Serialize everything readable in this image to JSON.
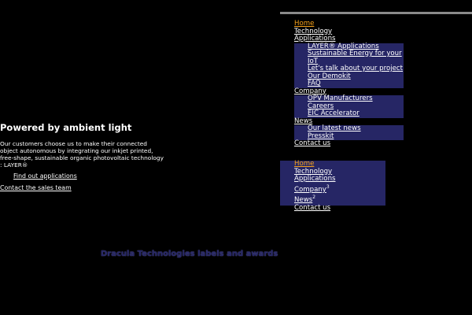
{
  "menu_primary": {
    "items": [
      {
        "label": "Home"
      },
      {
        "label": "Technology"
      },
      {
        "label": "Applications",
        "children": [
          {
            "label": "LAYER® Applications"
          },
          {
            "label": "Sustainable Energy for your IoT"
          },
          {
            "label": "Let's talk about your project"
          },
          {
            "label": "Our Demokit"
          },
          {
            "label": "FAQ"
          }
        ]
      },
      {
        "label": "Company",
        "children": [
          {
            "label": "OPV Manufacturers"
          },
          {
            "label": "Careers"
          },
          {
            "label": "EIC Accelerator"
          }
        ]
      },
      {
        "label": "News",
        "children": [
          {
            "label": "Our latest news"
          },
          {
            "label": "Presskit"
          }
        ]
      },
      {
        "label": "Contact us"
      }
    ]
  },
  "menu_secondary": {
    "items": [
      {
        "label": "Home"
      },
      {
        "label": "Technology"
      },
      {
        "label": "Applications"
      },
      {
        "label": "Company",
        "badge": "3"
      },
      {
        "label": "News",
        "badge": "2"
      },
      {
        "label": "Contact us"
      }
    ]
  },
  "hero": {
    "title": "Powered by ambient light",
    "text": "Our customers choose us to make their connected object autonomous by integrating our inkjet printed, free-shape, sustainable organic photovoltaic technology : LAYER®",
    "link_applications": "Find out applications",
    "link_sales": "Contact the sales team"
  },
  "labels_heading": "Dracula Technologies labels and awards",
  "colors": {
    "background": "#000000",
    "menu_bg": "#262665",
    "active": "#f7a21a",
    "text": "#ffffff"
  }
}
